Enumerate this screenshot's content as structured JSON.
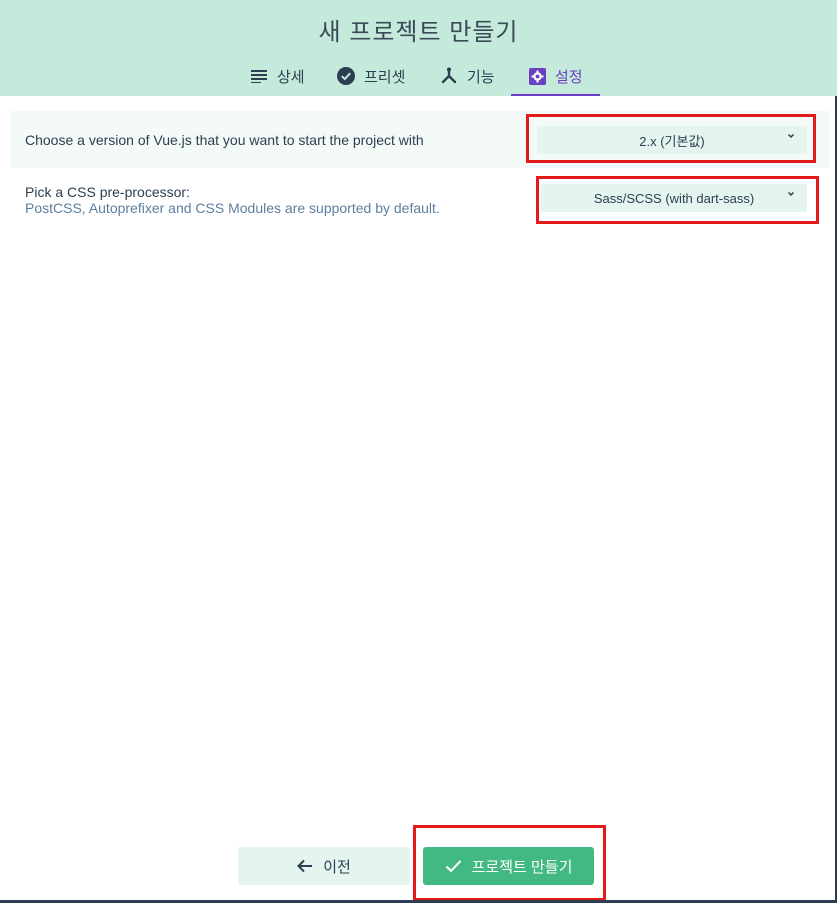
{
  "header": {
    "title": "새 프로젝트 만들기"
  },
  "tabs": [
    {
      "label": "상세",
      "icon": "list-icon"
    },
    {
      "label": "프리셋",
      "icon": "check-circle-icon"
    },
    {
      "label": "기능",
      "icon": "fork-icon"
    },
    {
      "label": "설정",
      "icon": "gear-icon",
      "active": true
    }
  ],
  "settings": {
    "vue_version": {
      "label": "Choose a version of Vue.js that you want to start the project with",
      "value": "2.x (기본값)"
    },
    "css_preprocessor": {
      "label": "Pick a CSS pre-processor:",
      "description": "PostCSS, Autoprefixer and CSS Modules are supported by default.",
      "value": "Sass/SCSS (with dart-sass)"
    }
  },
  "footer": {
    "prev_label": "이전",
    "create_label": "프로젝트 만들기"
  },
  "colors": {
    "header_bg": "#c5eadc",
    "accent_purple": "#6a3fc1",
    "primary_green": "#42b883",
    "highlight_red": "#e11a1a"
  }
}
